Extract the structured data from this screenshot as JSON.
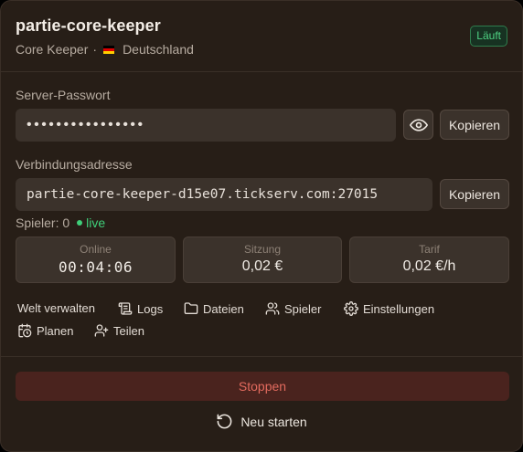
{
  "server": {
    "name": "partie-core-keeper",
    "game": "Core Keeper",
    "separator": "·",
    "country": "Deutschland",
    "flag_colors": [
      "#000000",
      "#dd0000",
      "#ffce00"
    ],
    "status": "Läuft",
    "status_color": "#4fd283"
  },
  "password": {
    "label": "Server-Passwort",
    "masked_value": "••••••••••••••••",
    "copy_label": "Kopieren",
    "toggle_icon": "eye-icon"
  },
  "address": {
    "label": "Verbindungsadresse",
    "value": "partie-core-keeper-d15e07.tickserv.com:27015",
    "copy_label": "Kopieren"
  },
  "players": {
    "label": "Spieler: 0",
    "live_label": "live",
    "live_color": "#3fce79"
  },
  "stats": [
    {
      "label": "Online",
      "value": "00:04:06"
    },
    {
      "label": "Sitzung",
      "value": "0,02 €"
    },
    {
      "label": "Tarif",
      "value": "0,02 €/h"
    }
  ],
  "actions": {
    "manage": "Welt verwalten",
    "logs": "Logs",
    "files": "Dateien",
    "players": "Spieler",
    "settings": "Einstellungen",
    "schedule": "Planen",
    "share": "Teilen"
  },
  "controls": {
    "stop_label": "Stoppen",
    "stop_color": "#e26a5e",
    "restart_label": "Neu starten"
  }
}
